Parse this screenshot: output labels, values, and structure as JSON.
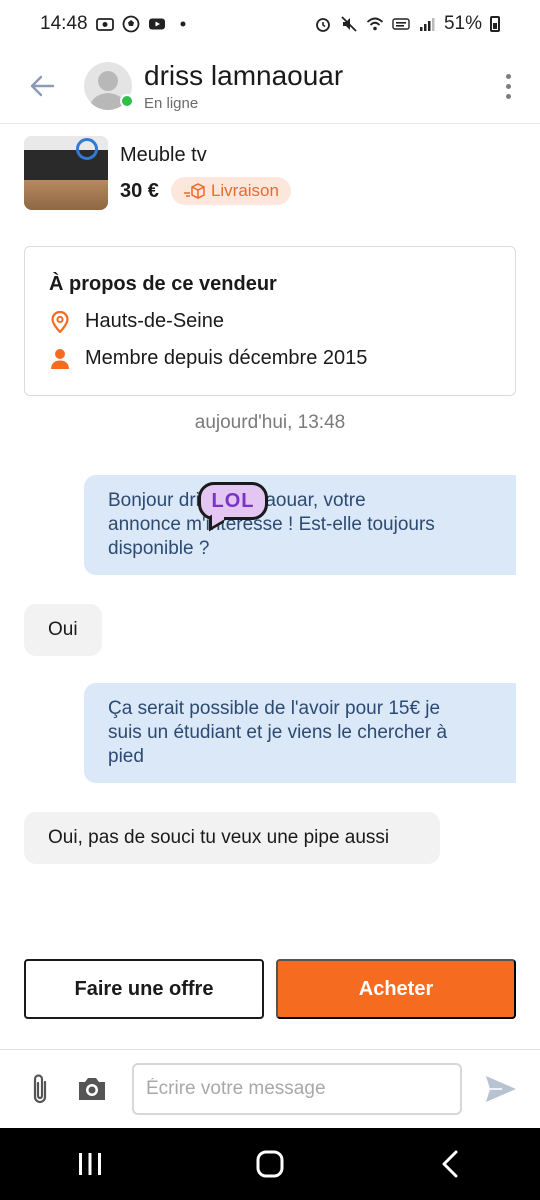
{
  "status_bar": {
    "time": "14:48",
    "battery": "51%",
    "left_icons": [
      "screen-record-icon",
      "soccer-icon",
      "youtube-icon",
      "dot-icon"
    ],
    "right_icons": [
      "alarm-icon",
      "mute-icon",
      "wifi-icon",
      "volte-icon",
      "signal-icon",
      "battery-icon"
    ]
  },
  "header": {
    "contact_name": "driss lamnaouar",
    "contact_status": "En ligne",
    "online_color": "#2fbf4a"
  },
  "product": {
    "title": "Meuble tv",
    "price": "30 €",
    "delivery_label": "Livraison"
  },
  "seller": {
    "heading": "À propos de ce vendeur",
    "location": "Hauts-de-Seine",
    "member_since": "Membre depuis décembre 2015"
  },
  "conversation": {
    "date_label": "aujourd'hui, 13:48",
    "messages": [
      {
        "direction": "out",
        "text_line1": "Bonjour driss lamnaouar, votre",
        "text_line2": "annonce m'intéresse ! Est-elle toujours",
        "text_line3": "disponible ?"
      },
      {
        "direction": "in",
        "text": "Oui"
      },
      {
        "direction": "out",
        "text_line1": "Ça serait possible de l'avoir pour 15€ je",
        "text_line2": "suis un étudiant et je viens le chercher à",
        "text_line3": "pied"
      },
      {
        "direction": "in",
        "text": "Oui, pas de souci tu veux une pipe aussi"
      }
    ],
    "sticker_text": "LOL"
  },
  "actions": {
    "offer_label": "Faire une offre",
    "buy_label": "Acheter",
    "accent_color": "#f56b1f"
  },
  "composer": {
    "placeholder": "Écrire votre message"
  },
  "nav": {
    "icons": [
      "recent-apps-icon",
      "home-icon",
      "back-nav-icon"
    ]
  }
}
